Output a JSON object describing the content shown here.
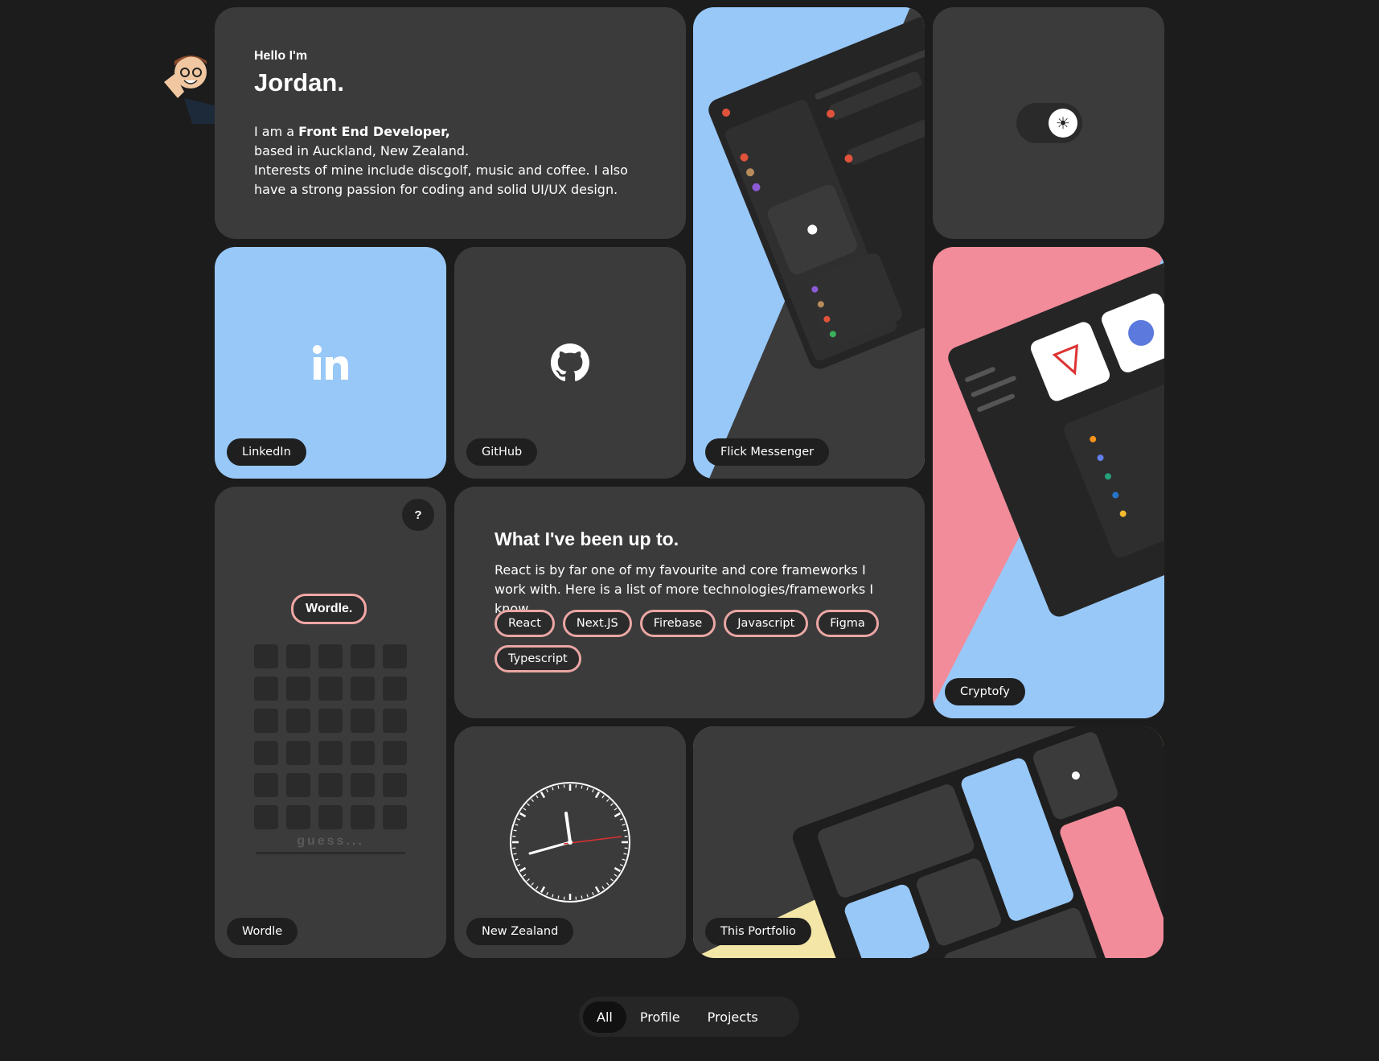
{
  "intro": {
    "hello": "Hello I'm",
    "name": "Jordan.",
    "line1_prefix": "I am a ",
    "line1_bold": "Front End Developer,",
    "line2": "based in Auckland, New Zealand.",
    "line3": "Interests of mine include discgolf, music and coffee. I also have a strong passion for coding and solid UI/UX design."
  },
  "cards": {
    "linkedin": "LinkedIn",
    "github": "GitHub",
    "flick": "Flick Messenger",
    "cryptofy": "Cryptofy",
    "wordle": "Wordle",
    "clock": "New Zealand",
    "portfolio": "This Portfolio"
  },
  "theme_toggle": {
    "icon": "sun-icon"
  },
  "wordle": {
    "help": "?",
    "logo": "Wordle.",
    "placeholder": "guess..."
  },
  "upto": {
    "title": "What I've been up to.",
    "desc": "React is by far one of my favourite and core frameworks I work with. Here is a list of more technologies/frameworks I know.",
    "chips": [
      "React",
      "Next.JS",
      "Firebase",
      "Javascript",
      "Figma",
      "Typescript"
    ]
  },
  "nav": {
    "items": [
      "All",
      "Profile",
      "Projects"
    ],
    "active": "All"
  },
  "colors": {
    "background": "#1c1c1c",
    "card": "#3b3b3b",
    "blue": "#98c8f8",
    "pink": "#f28c9a",
    "yellow": "#f3e6a6"
  }
}
